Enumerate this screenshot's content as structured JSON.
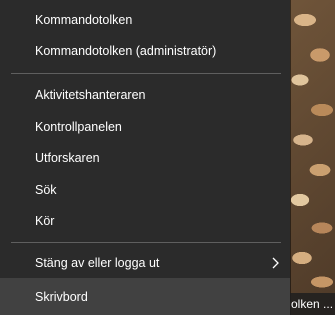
{
  "menu": {
    "items": [
      {
        "label": "Kommandotolken"
      },
      {
        "label": "Kommandotolken (administratör)"
      },
      {
        "label": "Aktivitetshanteraren"
      },
      {
        "label": "Kontrollpanelen"
      },
      {
        "label": "Utforskaren"
      },
      {
        "label": "Sök"
      },
      {
        "label": "Kör"
      },
      {
        "label": "Stäng av eller logga ut"
      },
      {
        "label": "Skrivbord"
      }
    ]
  },
  "taskbar": {
    "peek_label": "olken ..."
  },
  "icons": {
    "submenu": "chevron-right-icon"
  }
}
